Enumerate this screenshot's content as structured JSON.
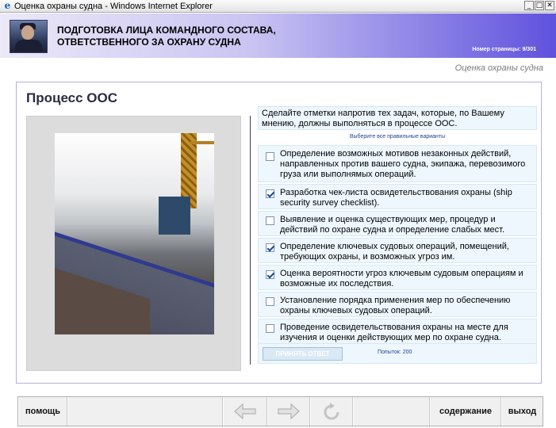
{
  "window": {
    "title": "Оценка охраны судна - Windows Internet Explorer",
    "min_glyph": "_",
    "max_glyph": "□",
    "close_glyph": "✕",
    "ie_glyph": "e"
  },
  "header": {
    "title_line1": "ПОДГОТОВКА ЛИЦА КОМАНДНОГО СОСТАВА,",
    "title_line2": "ОТВЕТСТВЕННОГО ЗА ОХРАНУ СУДНА",
    "page_number": "Номер страницы: 9/301"
  },
  "subtitle": "Оценка охраны судна",
  "panel": {
    "title": "Процесс ООС",
    "instruction": "Сделайте отметки напротив тех задач, которые, по Вашему мнению, должны выполняться в процессе ООС.",
    "hint": "Выберите все правильные варианты",
    "options": [
      {
        "text": "Определение возможных мотивов незаконных действий, направленных против вашего судна, экипажа, перевозимого груза или выполнямых операций.",
        "checked": false
      },
      {
        "text": "Разработка чек-листа освидетельствования охраны (ship security survey checklist).",
        "checked": true
      },
      {
        "text": "Выявление и оценка существующих мер, процедур и действий по охране судна и определение слабых мест.",
        "checked": false
      },
      {
        "text": "Определение ключевых судовых операций, помещений, требующих охраны, и возможных угроз им.",
        "checked": true
      },
      {
        "text": "Оценка вероятности угроз ключевым судовым операциям и возможные их последствия.",
        "checked": true
      },
      {
        "text": "Установление порядка применения мер по обеспечению охраны ключевых судовых операций.",
        "checked": false
      },
      {
        "text": "Проведение освидетельствования охраны на месте для изучения и оценки действующих мер по охране судна.",
        "checked": false
      }
    ],
    "submit_label": "ПРИНЯТЬ ОТВЕТ",
    "attempts": "Попыток: 200"
  },
  "footer": {
    "help": "помощь",
    "contents": "содержание",
    "exit": "выход",
    "icons": [
      "arrow-left-icon",
      "arrow-right-icon",
      "reload-icon"
    ]
  }
}
